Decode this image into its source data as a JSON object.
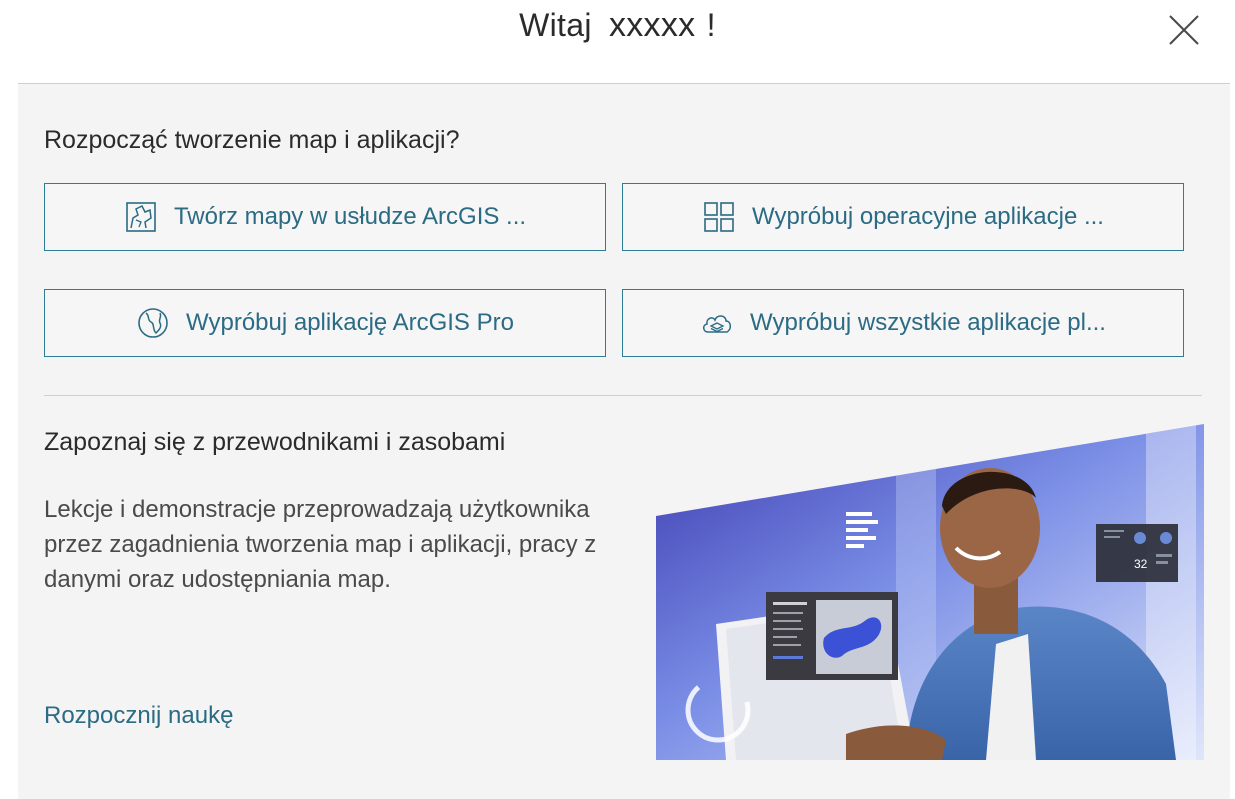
{
  "header": {
    "greeting": "Witaj",
    "username": "xxxxx",
    "exclamation": "!",
    "close_icon": "close-icon"
  },
  "start": {
    "question": "Rozpocząć tworzenie map i aplikacji?",
    "buttons": [
      {
        "label": "Twórz mapy w usłudze ArcGIS ...",
        "icon": "map-icon"
      },
      {
        "label": "Wypróbuj operacyjne aplikacje ...",
        "icon": "apps-grid-icon"
      },
      {
        "label": "Wypróbuj aplikację ArcGIS Pro",
        "icon": "globe-icon"
      },
      {
        "label": "Wypróbuj wszystkie aplikacje pl...",
        "icon": "cloud-layers-icon"
      }
    ]
  },
  "learn": {
    "title": "Zapoznaj się z przewodnikami i zasobami",
    "description": "Lekcje i demonstracje przeprowadzają użytkownika przez zagadnienia tworzenia map i aplikacji, pracy z danymi oraz udostępniania map.",
    "link": "Rozpocznij naukę",
    "hero_badge": "32"
  },
  "colors": {
    "accent": "#2c7e94",
    "link": "#2b6b84",
    "panel_bg": "#f4f4f4",
    "text": "#2b2b2b"
  }
}
